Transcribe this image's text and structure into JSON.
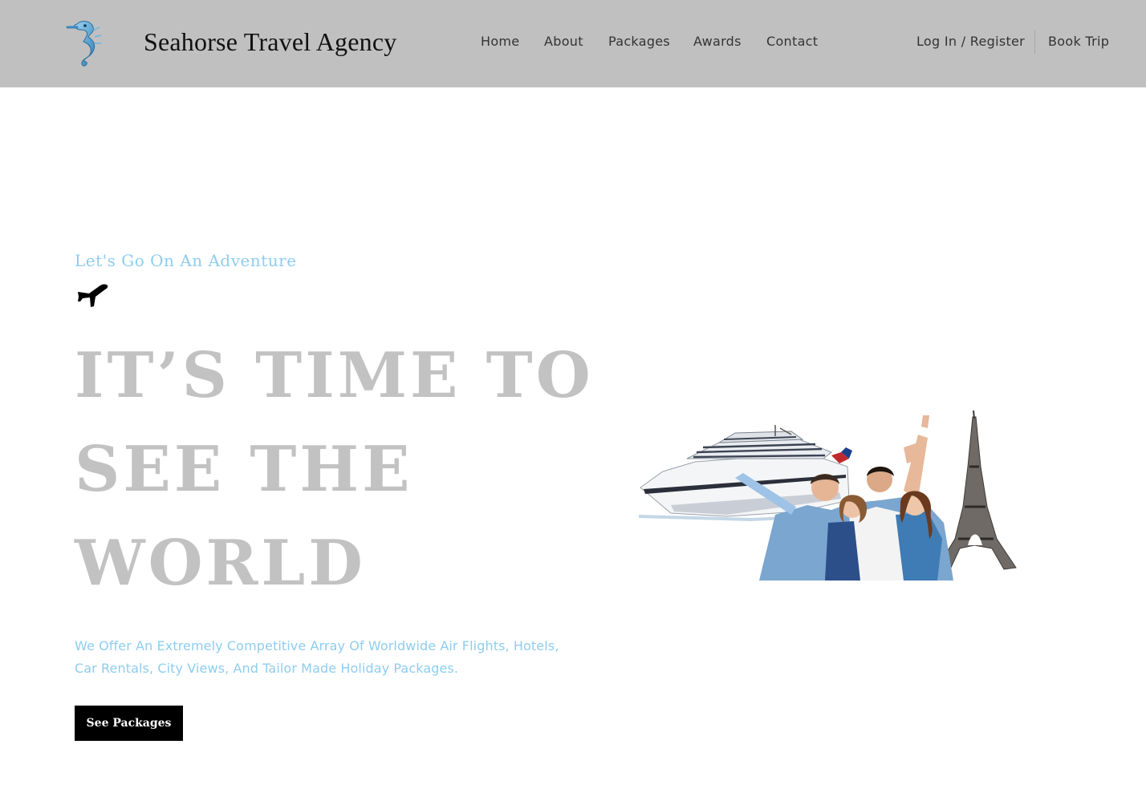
{
  "header": {
    "brand": "Seahorse Travel Agency",
    "logo_icon": "seahorse-icon",
    "nav": [
      {
        "label": "Home"
      },
      {
        "label": "About"
      },
      {
        "label": "Packages"
      },
      {
        "label": "Awards"
      },
      {
        "label": "Contact"
      }
    ],
    "login_label": "Log In / Register",
    "book_label": "Book Trip"
  },
  "hero": {
    "eyebrow": "Let's Go On An Adventure",
    "eyebrow_icon": "airplane-icon",
    "headline_lines": [
      "IT’S TIME TO",
      "SEE THE",
      "WORLD"
    ],
    "description": "We Offer An Extremely Competitive Array Of Worldwide Air Flights, Hotels, Car Rentals, City Views, And Tailor Made Holiday Packages.",
    "cta_label": "See Packages",
    "image_alt": "cruise-ship-people-eiffel-tower-collage"
  },
  "colors": {
    "header_bg": "#c0c0c0",
    "accent_blue": "#8ecdf0",
    "headline_gray": "#c2c2c2",
    "button_bg": "#000000"
  }
}
